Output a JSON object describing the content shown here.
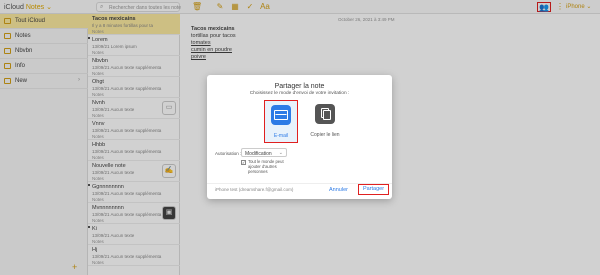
{
  "topbar": {
    "logo_icloud": "iCloud",
    "logo_app": "Notes",
    "logo_caret": "⌄",
    "search_placeholder": "Rechercher dans toutes les note",
    "device": "iPhone ⌄",
    "icons": [
      "trash-icon",
      "compose-icon",
      "table-icon",
      "checklist-icon",
      "font-icon",
      "share-contacts-icon",
      "more-icon"
    ]
  },
  "sidebar": {
    "folders": [
      {
        "label": "Tout iCloud",
        "selected": true
      },
      {
        "label": "Notes"
      },
      {
        "label": "Nbvbn"
      },
      {
        "label": "Info"
      },
      {
        "label": "New",
        "chevron": "›"
      }
    ],
    "add": "+"
  },
  "notes_list": {
    "items": [
      {
        "title": "Tacos mexicains",
        "date": "Il y a 8 minutes fortillas pour ta",
        "folder": "Notes",
        "selected": true
      },
      {
        "title": "Lorem",
        "date": "13/09/21  Lorem ipsum",
        "folder": "Notes"
      },
      {
        "title": "Nbvbn",
        "date": "13/09/21  Aucun texte supplémenta",
        "folder": "Notes"
      },
      {
        "title": "Ohgt",
        "date": "13/09/21  Aucun texte supplémenta",
        "folder": "Notes"
      },
      {
        "title": "Nvnh",
        "date": "13/09/21  Aucun texte",
        "folder": "Notes"
      },
      {
        "title": "Vnnv",
        "date": "13/09/21  Aucun texte supplémenta",
        "folder": "Notes"
      },
      {
        "title": "Hhbb",
        "date": "13/09/21  Aucun texte supplémenta",
        "folder": "Notes"
      },
      {
        "title": "Nouvelle note",
        "date": "13/09/21  Aucun texte",
        "folder": "Notes"
      },
      {
        "title": "Ggnnnnnnnn",
        "date": "13/09/21  Aucun texte supplémenta",
        "folder": "Notes"
      },
      {
        "title": "Mvnnnnnnnn",
        "date": "13/09/21  Aucun texte supplémenta",
        "folder": "Notes"
      },
      {
        "title": "Ki",
        "date": "13/09/21  Aucun texte",
        "folder": "Notes"
      },
      {
        "title": "Hj",
        "date": "13/09/21  Aucun texte supplémenta",
        "folder": "Notes"
      }
    ]
  },
  "content": {
    "date": "October 26, 2021 à 3:49 PM",
    "title": "Tacos mexicains",
    "lines": [
      "tortillas pour tacos",
      "tomates",
      "cumin en poudre",
      "poivre"
    ]
  },
  "modal": {
    "title": "Partager la note",
    "subtitle": "Choisissez le mode d'envoi de votre invitation :",
    "option_email": "E-mail",
    "option_copy": "Copier le lien",
    "permission_label": "Autorisation :",
    "permission_value": "Modification",
    "checkbox_label": "Tout le monde peut ajouter d'autres personnes",
    "checkbox_mark": "✓",
    "account_text": "iPhone test (dreamshare.f@gmail.com)",
    "cancel": "Annuler",
    "share": "Partager"
  },
  "colors": {
    "accent": "#d4a017",
    "selection": "#fbe9a0",
    "highlight_box": "#e02020",
    "link_blue": "#2d7be6"
  }
}
